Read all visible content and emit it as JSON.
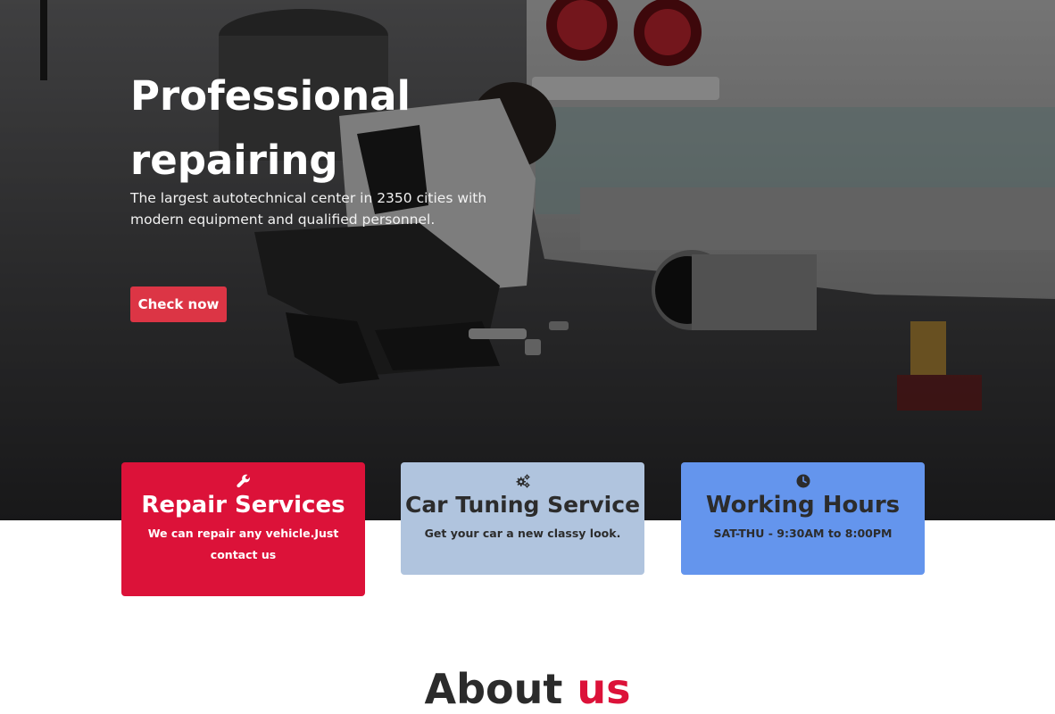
{
  "hero": {
    "title": "Professional repairing",
    "subtitle": "The largest autotechnical center in 2350 cities with modern equipment and qualified personnel.",
    "cta_label": "Check now",
    "background_image": "mechanic-under-car-photo"
  },
  "cards": [
    {
      "icon": "wrench-icon",
      "title": "Repair Services",
      "text": "We can repair any vehicle.Just contact us",
      "color": "#dc1239"
    },
    {
      "icon": "gears-icon",
      "title": "Car Tuning Service",
      "text": "Get your car a new classy look.",
      "color": "#b0c4de"
    },
    {
      "icon": "clock-icon",
      "title": "Working Hours",
      "text": "SAT-THU - 9:30AM to 8:00PM",
      "color": "#6495ed"
    }
  ],
  "about": {
    "heading_main": "About",
    "heading_accent": "us",
    "accent_color": "#dc1239"
  },
  "colors": {
    "cta": "#dc3545",
    "text_dark": "#2b2b2b"
  }
}
